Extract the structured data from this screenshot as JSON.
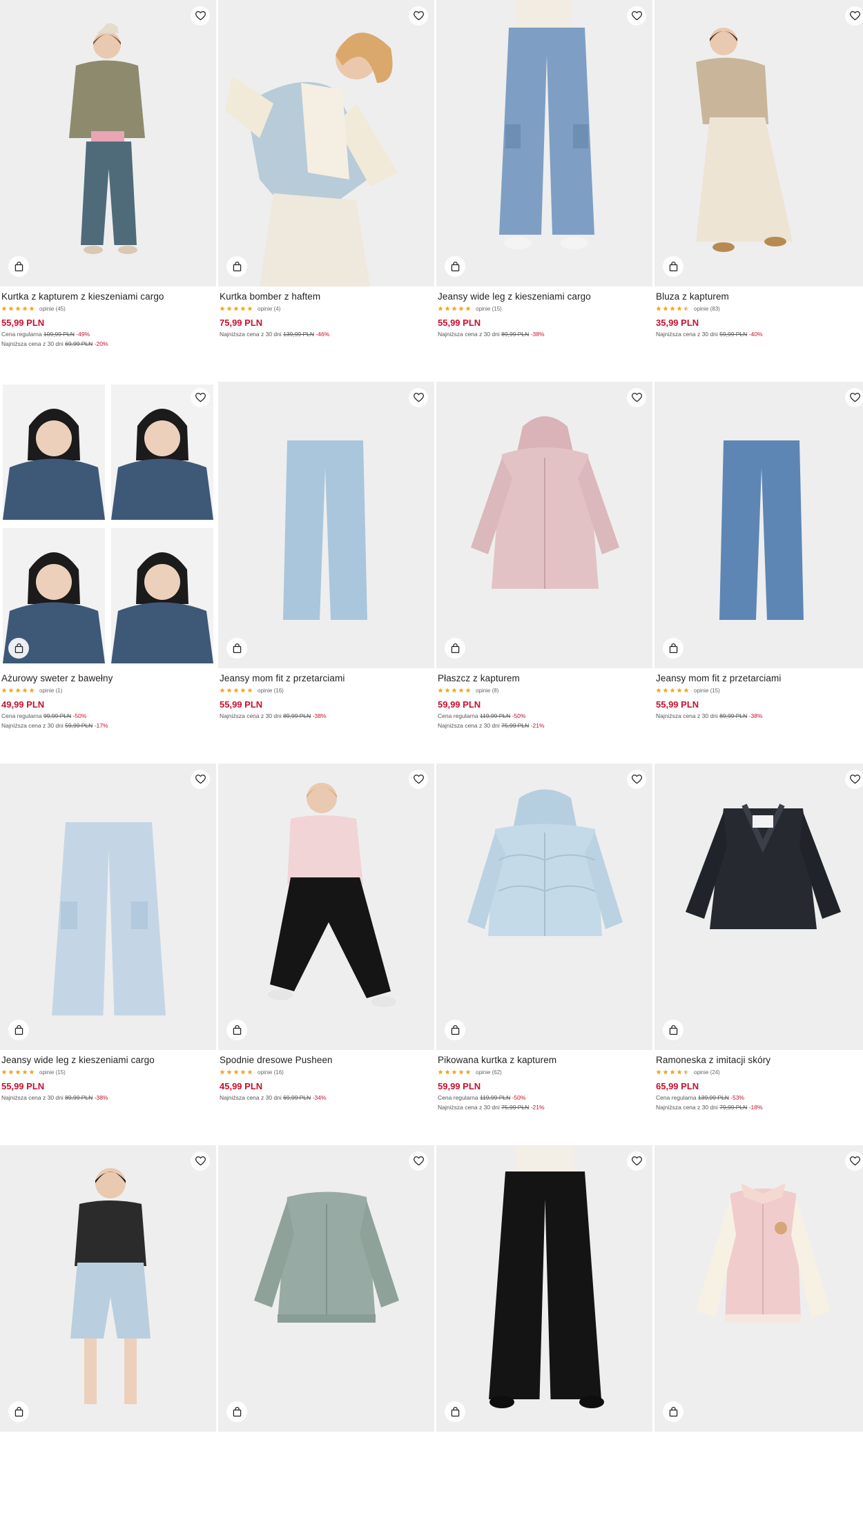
{
  "products": [
    {
      "name": "Kurtka z kapturem z kieszeniami cargo",
      "stars": 5,
      "reviews": "opinie (45)",
      "price": "55,99 PLN",
      "regular": {
        "label": "Cena regularna",
        "old": "109,99 PLN",
        "pct": "-49%"
      },
      "lowest": {
        "label": "Najniższa cena z 30 dni",
        "old": "69,99 PLN",
        "pct": "-20%"
      },
      "image": "girl-khaki-jacket-wide-jeans"
    },
    {
      "name": "Kurtka bomber z haftem",
      "stars": 5,
      "reviews": "opinie (4)",
      "price": "75,99 PLN",
      "lowest": {
        "label": "Najniższa cena z 30 dni",
        "old": "139,99 PLN",
        "pct": "-46%"
      },
      "image": "girl-bomber-jacket"
    },
    {
      "name": "Jeansy wide leg z kieszeniami cargo",
      "stars": 5,
      "reviews": "opinie (15)",
      "price": "55,99 PLN",
      "lowest": {
        "label": "Najniższa cena z 30 dni",
        "old": "89,99 PLN",
        "pct": "-38%"
      },
      "image": "cargo-jeans-model"
    },
    {
      "name": "Bluza z kapturem",
      "stars": 4.5,
      "reviews": "opinie (83)",
      "price": "35,99 PLN",
      "lowest": {
        "label": "Najniższa cena z 30 dni",
        "old": "59,99 PLN",
        "pct": "-40%"
      },
      "image": "girl-beige-hoodie"
    },
    {
      "name": "Ażurowy sweter z bawełny",
      "stars": 5,
      "reviews": "opinie (1)",
      "price": "49,99 PLN",
      "regular": {
        "label": "Cena regularna",
        "old": "99,99 PLN",
        "pct": "-50%"
      },
      "lowest": {
        "label": "Najniższa cena z 30 dni",
        "old": "59,99 PLN",
        "pct": "-17%"
      },
      "image": "girl-knit-sweater-collage"
    },
    {
      "name": "Jeansy mom fit z przetarciami",
      "stars": 5,
      "reviews": "opinie (16)",
      "price": "55,99 PLN",
      "lowest": {
        "label": "Najniższa cena z 30 dni",
        "old": "89,99 PLN",
        "pct": "-38%"
      },
      "image": "light-mom-jeans"
    },
    {
      "name": "Płaszcz z kapturem",
      "stars": 5,
      "reviews": "opinie (8)",
      "price": "59,99 PLN",
      "regular": {
        "label": "Cena regularna",
        "old": "119,99 PLN",
        "pct": "-50%"
      },
      "lowest": {
        "label": "Najniższa cena z 30 dni",
        "old": "75,99 PLN",
        "pct": "-21%"
      },
      "image": "pink-hooded-coat"
    },
    {
      "name": "Jeansy mom fit z przetarciami",
      "stars": 5,
      "reviews": "opinie (15)",
      "price": "55,99 PLN",
      "lowest": {
        "label": "Najniższa cena z 30 dni",
        "old": "89,99 PLN",
        "pct": "-38%"
      },
      "image": "medium-mom-jeans"
    },
    {
      "name": "Jeansy wide leg z kieszeniami cargo",
      "stars": 5,
      "reviews": "opinie (15)",
      "price": "55,99 PLN",
      "lowest": {
        "label": "Najniższa cena z 30 dni",
        "old": "89,99 PLN",
        "pct": "-38%"
      },
      "image": "light-cargo-jeans"
    },
    {
      "name": "Spodnie dresowe Pusheen",
      "stars": 5,
      "reviews": "opinie (16)",
      "price": "45,99 PLN",
      "lowest": {
        "label": "Najniższa cena z 30 dni",
        "old": "69,99 PLN",
        "pct": "-34%"
      },
      "image": "girl-black-joggers"
    },
    {
      "name": "Pikowana kurtka z kapturem",
      "stars": 5,
      "reviews": "opinie (62)",
      "price": "59,99 PLN",
      "regular": {
        "label": "Cena regularna",
        "old": "119,99 PLN",
        "pct": "-50%"
      },
      "lowest": {
        "label": "Najniższa cena z 30 dni",
        "old": "75,99 PLN",
        "pct": "-21%"
      },
      "image": "blue-puffer-jacket"
    },
    {
      "name": "Ramoneska z imitacji skóry",
      "stars": 4.5,
      "reviews": "opinie (24)",
      "price": "65,99 PLN",
      "regular": {
        "label": "Cena regularna",
        "old": "139,99 PLN",
        "pct": "-53%"
      },
      "lowest": {
        "label": "Najniższa cena z 30 dni",
        "old": "79,99 PLN",
        "pct": "-18%"
      },
      "image": "black-biker-jacket"
    },
    {
      "name": "",
      "stars": 0,
      "reviews": "",
      "price": "",
      "image": "girl-black-sweater-denim-shorts"
    },
    {
      "name": "",
      "stars": 0,
      "reviews": "",
      "price": "",
      "image": "sage-bomber-jacket"
    },
    {
      "name": "",
      "stars": 0,
      "reviews": "",
      "price": "",
      "image": "black-flared-jeans"
    },
    {
      "name": "",
      "stars": 0,
      "reviews": "",
      "price": "",
      "image": "pink-varsity-jacket"
    }
  ],
  "colors": {
    "price": "#c8102e",
    "star": "#f5a623",
    "image_bg": "#efefef"
  }
}
